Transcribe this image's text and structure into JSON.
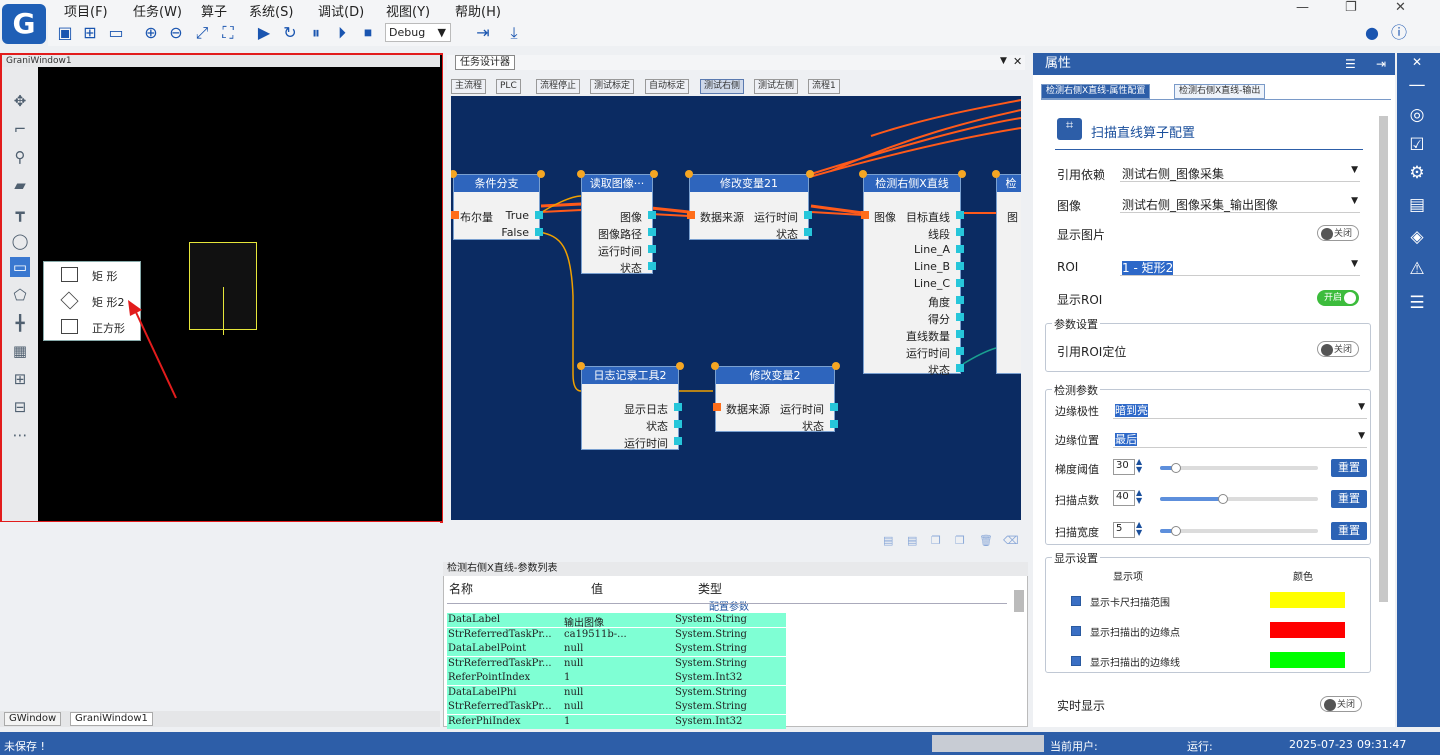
{
  "app": {
    "logo_letter": "G"
  },
  "menu": [
    "项目(F)",
    "任务(W)",
    "算子",
    "系统(S)",
    "调试(D)",
    "视图(Y)",
    "帮助(H)"
  ],
  "toolbar": {
    "mode": "Debug"
  },
  "left_window": {
    "title": "GraniWindow1",
    "shape_menu": [
      "矩 形",
      "矩 形2",
      "正方形"
    ]
  },
  "bottom_tabs": [
    "GWindow",
    "GraniWindow1"
  ],
  "center": {
    "main_tab": "任务设计器",
    "tabs": [
      "主流程",
      "PLC",
      "流程停止",
      "测试标定",
      "自动标定",
      "测试右侧",
      "测试左侧",
      "流程1"
    ],
    "active_tab": "测试右侧",
    "nodes": {
      "branch": {
        "title": "条件分支",
        "in": "布尔量",
        "out1": "True",
        "out2": "False"
      },
      "read": {
        "title": "读取图像···",
        "rows": [
          "图像",
          "图像路径",
          "运行时间",
          "状态"
        ]
      },
      "var21": {
        "title": "修改变量21",
        "left": "数据来源",
        "right1": "运行时间",
        "right2": "状态"
      },
      "detect": {
        "title": "检测右侧X直线",
        "left": "图像",
        "rows": [
          "目标直线",
          "线段",
          "Line_A",
          "Line_B",
          "Line_C",
          "角度",
          "得分",
          "直线数量",
          "运行时间",
          "状态"
        ]
      },
      "extra": {
        "title": "检",
        "left": "图"
      },
      "log": {
        "title": "日志记录工具2",
        "rows": [
          "显示日志",
          "状态",
          "运行时间"
        ]
      },
      "var2": {
        "title": "修改变量2",
        "left": "数据来源",
        "right1": "运行时间",
        "right2": "状态"
      }
    }
  },
  "params": {
    "title": "检测右侧X直线-参数列表",
    "headers": [
      "名称",
      "值",
      "类型"
    ],
    "section": "配置参数",
    "rows": [
      [
        "DataLabel",
        "输出图像",
        "System.String"
      ],
      [
        "StrReferredTaskPr...",
        "ca19511b-...",
        "System.String"
      ],
      [
        "DataLabelPoint",
        "null",
        "System.String"
      ],
      [
        "StrReferredTaskPr...",
        "null",
        "System.String"
      ],
      [
        "ReferPointIndex",
        "1",
        "System.Int32"
      ],
      [
        "DataLabelPhi",
        "null",
        "System.String"
      ],
      [
        "StrReferredTaskPr...",
        "null",
        "System.String"
      ],
      [
        "ReferPhiIndex",
        "1",
        "System.Int32"
      ]
    ]
  },
  "props": {
    "header": "属性",
    "tabs": [
      "检测右侧X直线-属性配置",
      "检测右侧X直线-输出"
    ],
    "title": "扫描直线算子配置",
    "ref_label": "引用依赖",
    "ref_value": "测试右侧_图像采集",
    "image_label": "图像",
    "image_value": "测试右侧_图像采集_输出图像",
    "show_image_label": "显示图片",
    "show_image_state": "关闭",
    "roi_label": "ROI",
    "roi_value": "1 - 矩形2",
    "show_roi_label": "显示ROI",
    "show_roi_state": "开启",
    "param_group": "参数设置",
    "roi_pos_label": "引用ROI定位",
    "roi_pos_state": "关闭",
    "detect_group": "检测参数",
    "polarity_label": "边缘极性",
    "polarity_value": "暗到亮",
    "position_label": "边缘位置",
    "position_value": "最后",
    "grad_label": "梯度阈值",
    "grad_value": "30",
    "grad_level": 0.1,
    "points_label": "扫描点数",
    "points_value": "40",
    "points_level": 0.4,
    "width_label": "扫描宽度",
    "width_value": "5",
    "width_level": 0.1,
    "reset": "重置",
    "display_group": "显示设置",
    "display_col1": "显示项",
    "display_col2": "颜色",
    "display_items": [
      {
        "label": "显示卡尺扫描范围",
        "color": "#ffff00"
      },
      {
        "label": "显示扫描出的边缘点",
        "color": "#ff0000"
      },
      {
        "label": "显示扫描出的边缘线",
        "color": "#00ff00"
      }
    ],
    "realtime_label": "实时显示",
    "realtime_state": "关闭"
  },
  "status": {
    "save": "未保存 !",
    "user_label": "当前用户:",
    "run_label": "运行:",
    "date": "2025-07-23",
    "time": "09:31:47"
  }
}
